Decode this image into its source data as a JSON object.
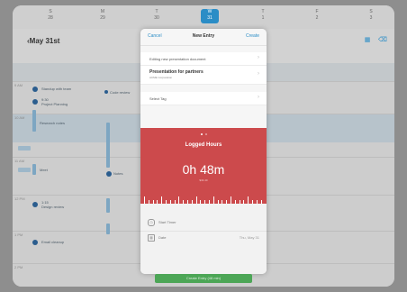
{
  "days": [
    {
      "weekday": "S",
      "num": "28"
    },
    {
      "weekday": "M",
      "num": "29"
    },
    {
      "weekday": "T",
      "num": "30"
    },
    {
      "weekday": "W",
      "num": "31"
    },
    {
      "weekday": "T",
      "num": "1"
    },
    {
      "weekday": "F",
      "num": "2"
    },
    {
      "weekday": "S",
      "num": "3"
    }
  ],
  "header": {
    "date_title": "May 31st"
  },
  "calendar": {
    "hour_labels": [
      "9 AM",
      "10 AM",
      "11 AM",
      "12 PM",
      "1 PM",
      "2 PM"
    ],
    "events": [
      {
        "time": "9:00",
        "title": "Standup with team",
        "sub": "Prepare notes"
      },
      {
        "time": "9:30",
        "title": "Project Planning",
        "sub": "Marketing site update"
      },
      {
        "time": "10:30",
        "title": "Research notes",
        "sub": ""
      },
      {
        "time": "12:00",
        "title": "Meet",
        "sub": ""
      },
      {
        "time": "1:15",
        "title": "Design review",
        "sub": "Feedback sync"
      },
      {
        "time": "2:00",
        "title": "Code review",
        "sub": ""
      },
      {
        "time": "3:00",
        "title": "Email cleanup",
        "sub": ""
      },
      {
        "time": "3:30",
        "title": "Notes",
        "sub": ""
      }
    ]
  },
  "modal": {
    "cancel": "Cancel",
    "title": "New Entry",
    "create": "Create",
    "description": "Editing new presentation document",
    "project_name": "Presentation for partners",
    "project_client": "ACME Corporation",
    "tag_label": "Select Tag",
    "logged_title": "Logged Hours",
    "logged_value": "0h 48m",
    "logged_sub": "$34.40",
    "start_timer": "Start Timer",
    "date_label": "Date",
    "date_value": "Thu, May 31"
  },
  "bottom_button": "Create Entry (48 min)",
  "colors": {
    "accent": "#2b8dc6",
    "logged_red": "#cc4a4c",
    "button_green": "#4ca656"
  }
}
